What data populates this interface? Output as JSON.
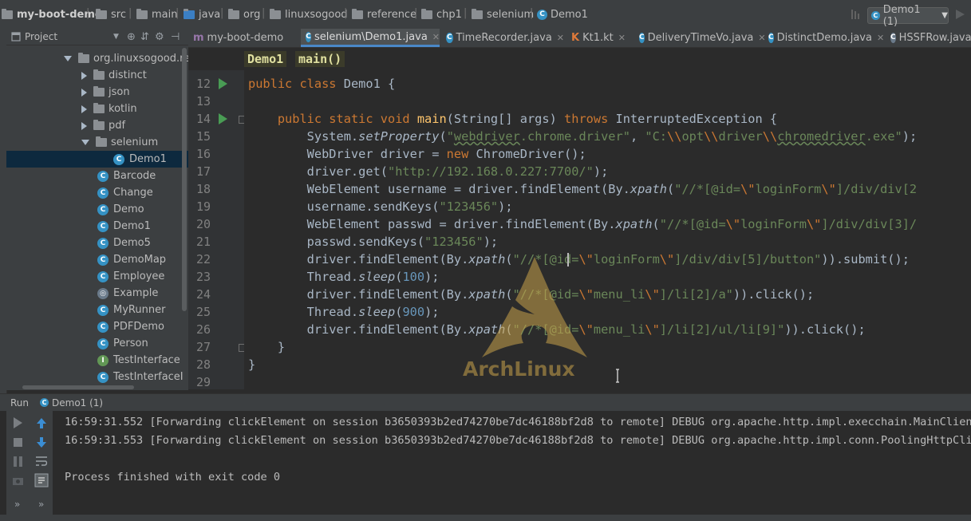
{
  "breadcrumb": {
    "items": [
      "my-boot-demo",
      "src",
      "main",
      "java",
      "org",
      "linuxsogood",
      "reference",
      "chp1",
      "selenium",
      "Demo1"
    ]
  },
  "toolbar": {
    "run_config": "Demo1 (1)"
  },
  "project_panel": {
    "title": "Project",
    "tree": [
      {
        "label": "org.linuxsogood.ref",
        "kind": "package",
        "state": "expanded"
      },
      {
        "label": "distinct",
        "kind": "folder",
        "state": "collapsed"
      },
      {
        "label": "json",
        "kind": "folder",
        "state": "collapsed"
      },
      {
        "label": "kotlin",
        "kind": "folder",
        "state": "collapsed"
      },
      {
        "label": "pdf",
        "kind": "folder",
        "state": "collapsed"
      },
      {
        "label": "selenium",
        "kind": "folder",
        "state": "expanded"
      },
      {
        "label": "Demo1",
        "kind": "class",
        "state": "selected"
      },
      {
        "label": "Barcode",
        "kind": "class"
      },
      {
        "label": "Change",
        "kind": "class"
      },
      {
        "label": "Demo",
        "kind": "class"
      },
      {
        "label": "Demo1",
        "kind": "class"
      },
      {
        "label": "Demo5",
        "kind": "class"
      },
      {
        "label": "DemoMap",
        "kind": "class"
      },
      {
        "label": "Employee",
        "kind": "class"
      },
      {
        "label": "Example",
        "kind": "class"
      },
      {
        "label": "MyRunner",
        "kind": "class"
      },
      {
        "label": "PDFDemo",
        "kind": "class"
      },
      {
        "label": "Person",
        "kind": "class"
      },
      {
        "label": "TestInterface",
        "kind": "interface"
      },
      {
        "label": "TestInterfaceI",
        "kind": "class"
      }
    ]
  },
  "tabs": [
    {
      "label": "my-boot-demo",
      "active": false
    },
    {
      "label": "selenium\\Demo1.java",
      "active": true
    },
    {
      "label": "TimeRecorder.java",
      "active": false
    },
    {
      "label": "Kt1.kt",
      "active": false
    },
    {
      "label": "DeliveryTimeVo.java",
      "active": false
    },
    {
      "label": "DistinctDemo.java",
      "active": false
    },
    {
      "label": "HSSFRow.java",
      "active": false
    }
  ],
  "method_breadcrumb": [
    "Demo1",
    "main()"
  ],
  "editor": {
    "line_numbers": [
      "12",
      "13",
      "14",
      "15",
      "16",
      "17",
      "18",
      "19",
      "20",
      "21",
      "22",
      "23",
      "24",
      "25",
      "26",
      "27",
      "28",
      "29"
    ]
  },
  "watermark": {
    "text": "ArchLinux"
  },
  "run_panel": {
    "label": "Run",
    "config": "Demo1 (1)",
    "console": [
      "16:59:31.552 [Forwarding clickElement on session b3650393b2ed74270be7dc46188bf2d8 to remote] DEBUG org.apache.http.impl.execchain.MainClientEx",
      "16:59:31.553 [Forwarding clickElement on session b3650393b2ed74270be7dc46188bf2d8 to remote] DEBUG org.apache.http.impl.conn.PoolingHttpClient",
      "",
      "Process finished with exit code 0"
    ]
  },
  "colors": {
    "keyword": "#cc7832",
    "string": "#6a8759",
    "method": "#ffc66d",
    "number": "#6897bb",
    "background": "#2b2b2b"
  }
}
